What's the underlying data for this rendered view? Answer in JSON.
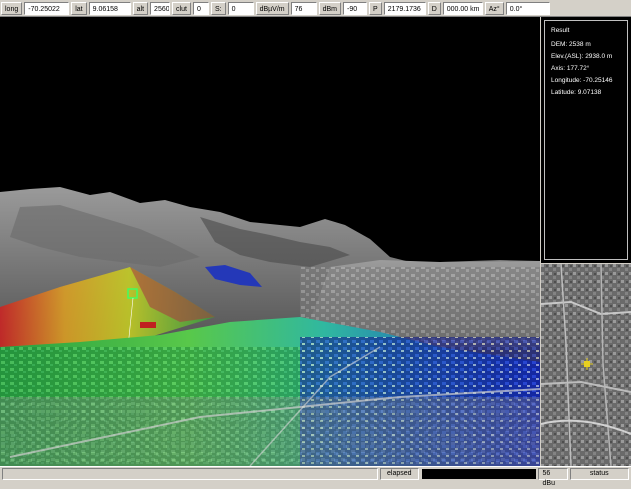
{
  "toolbar": {
    "long_label": "long",
    "long_value": "-70.25022",
    "lat_label": "lat",
    "lat_value": "9.06158",
    "alt_label": "alt",
    "alt_value": "2560",
    "clut_label": "clut",
    "clut_value": "0",
    "s_label": "S:",
    "s_value": "0",
    "dbuvm_label": "dBµV/m",
    "dbuvm_value": "76",
    "dbm_label": "dBm",
    "dbm_value": "-90",
    "p_label": "P",
    "p_value": "2179.1736",
    "d_label": "D",
    "d_value": "000.00 km",
    "az_label": "Az°",
    "az_value": "0.0°"
  },
  "result": {
    "title": "Result",
    "dem": "DEM: 2538 m",
    "elev": "Elev.(ASL): 2938.0 m",
    "axis": "Axis: 177.72°",
    "longitude": "Longitude: -70.25146",
    "latitude": "Latitude: 9.07138"
  },
  "statusbar": {
    "elapsed_label": "elapsed",
    "value": "56 dBu",
    "status_label": "status"
  },
  "colors": {
    "sky": "#000000",
    "coverage_high": "#d01818",
    "coverage_mid": "#e8c820",
    "coverage_low": "#20b040",
    "coverage_edge": "#1830c8"
  }
}
